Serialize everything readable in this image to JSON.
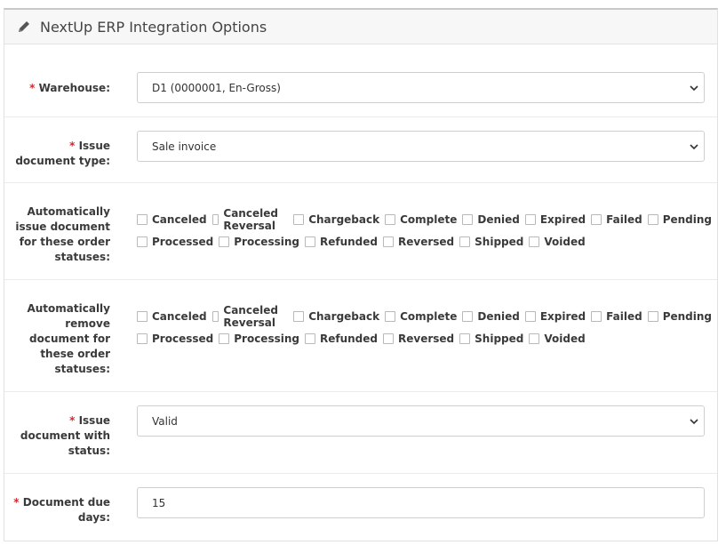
{
  "header": {
    "title": "NextUp ERP Integration Options"
  },
  "warehouse": {
    "label": "Warehouse:",
    "value": "D1 (0000001, En-Gross)"
  },
  "doc_type": {
    "label_line1": "Issue",
    "label_line2": "document type:",
    "value": "Sale invoice"
  },
  "auto_issue": {
    "label_lines": [
      "Automatically",
      "issue document",
      "for these order",
      "statuses:"
    ],
    "row1": [
      "Canceled",
      "Canceled Reversal",
      "Chargeback",
      "Complete",
      "Denied",
      "Expired",
      "Failed",
      "Pending"
    ],
    "row2": [
      "Processed",
      "Processing",
      "Refunded",
      "Reversed",
      "Shipped",
      "Voided"
    ]
  },
  "auto_remove": {
    "label_lines": [
      "Automatically",
      "remove",
      "document for",
      "these order",
      "statuses:"
    ],
    "row1": [
      "Canceled",
      "Canceled Reversal",
      "Chargeback",
      "Complete",
      "Denied",
      "Expired",
      "Failed",
      "Pending"
    ],
    "row2": [
      "Processed",
      "Processing",
      "Refunded",
      "Reversed",
      "Shipped",
      "Voided"
    ]
  },
  "doc_status": {
    "label_lines": [
      "Issue",
      "document with",
      "status:"
    ],
    "value": "Valid"
  },
  "due_days": {
    "label_line1": "Document due",
    "label_line2": "days:",
    "value": "15"
  },
  "required_marker": "*"
}
